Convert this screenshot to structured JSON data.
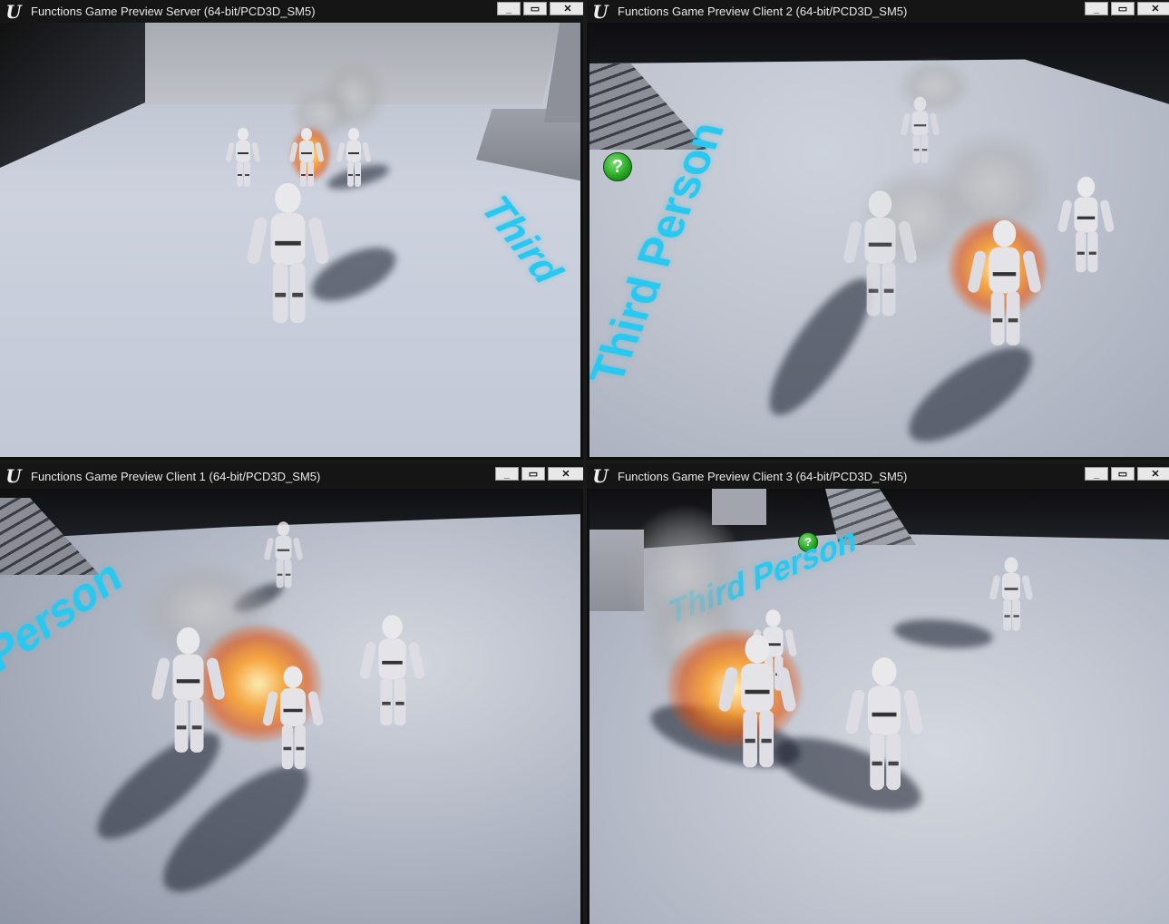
{
  "windows": [
    {
      "id": "server",
      "title": "Functions Game Preview Server (64-bit/PCD3D_SM5)",
      "viewport_label": ""
    },
    {
      "id": "client2",
      "title": "Functions Game Preview Client 2 (64-bit/PCD3D_SM5)",
      "viewport_label": "Third Person"
    },
    {
      "id": "client1",
      "title": "Functions Game Preview Client 1 (64-bit/PCD3D_SM5)",
      "viewport_label": "Person"
    },
    {
      "id": "client3",
      "title": "Functions Game Preview Client 3 (64-bit/PCD3D_SM5)",
      "viewport_label": "Third Person"
    }
  ],
  "window_controls": {
    "minimize": "_",
    "maximize": "▭",
    "close": "✕"
  },
  "server_text": "Third",
  "help_marker": "?",
  "colors": {
    "title_bar": "#151515",
    "floor": "#c9cfdc",
    "text_label": "#28c8f0",
    "help_marker": "#23a21f"
  },
  "icons": [
    "unreal-engine-logo-icon",
    "minimize-icon",
    "maximize-icon",
    "close-icon",
    "help-marker-icon"
  ]
}
